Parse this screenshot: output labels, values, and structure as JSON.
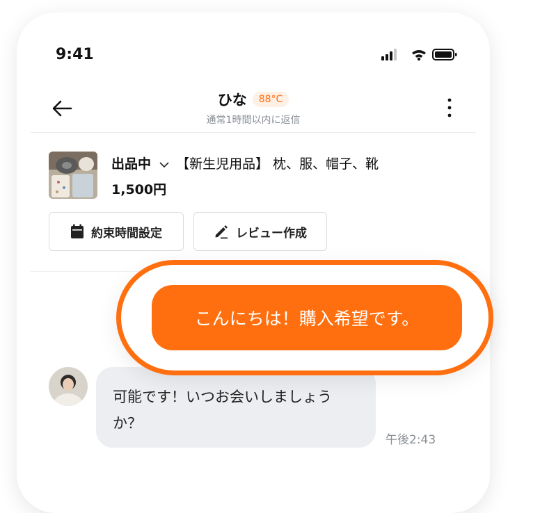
{
  "status_bar": {
    "time": "9:41",
    "icons": [
      "signal-icon",
      "wifi-icon",
      "battery-icon"
    ]
  },
  "header": {
    "name": "ひな",
    "temperature": "88°C",
    "subtitle": "通常1時間以内に返信"
  },
  "product": {
    "status": "出品中",
    "title": "【新生児用品】 枕、服、帽子、靴",
    "price": "1,500円"
  },
  "actions": {
    "schedule_label": "約束時間設定",
    "review_label": "レビュー作成"
  },
  "messages": {
    "outgoing": "こんにちは！購入希望です。",
    "incoming": "可能です！いつお会いしましょうか？",
    "incoming_time": "午後2:43"
  },
  "colors": {
    "accent": "#ff6f0f",
    "bubble_in": "#eceef1",
    "text_gray": "#8a8f96"
  }
}
